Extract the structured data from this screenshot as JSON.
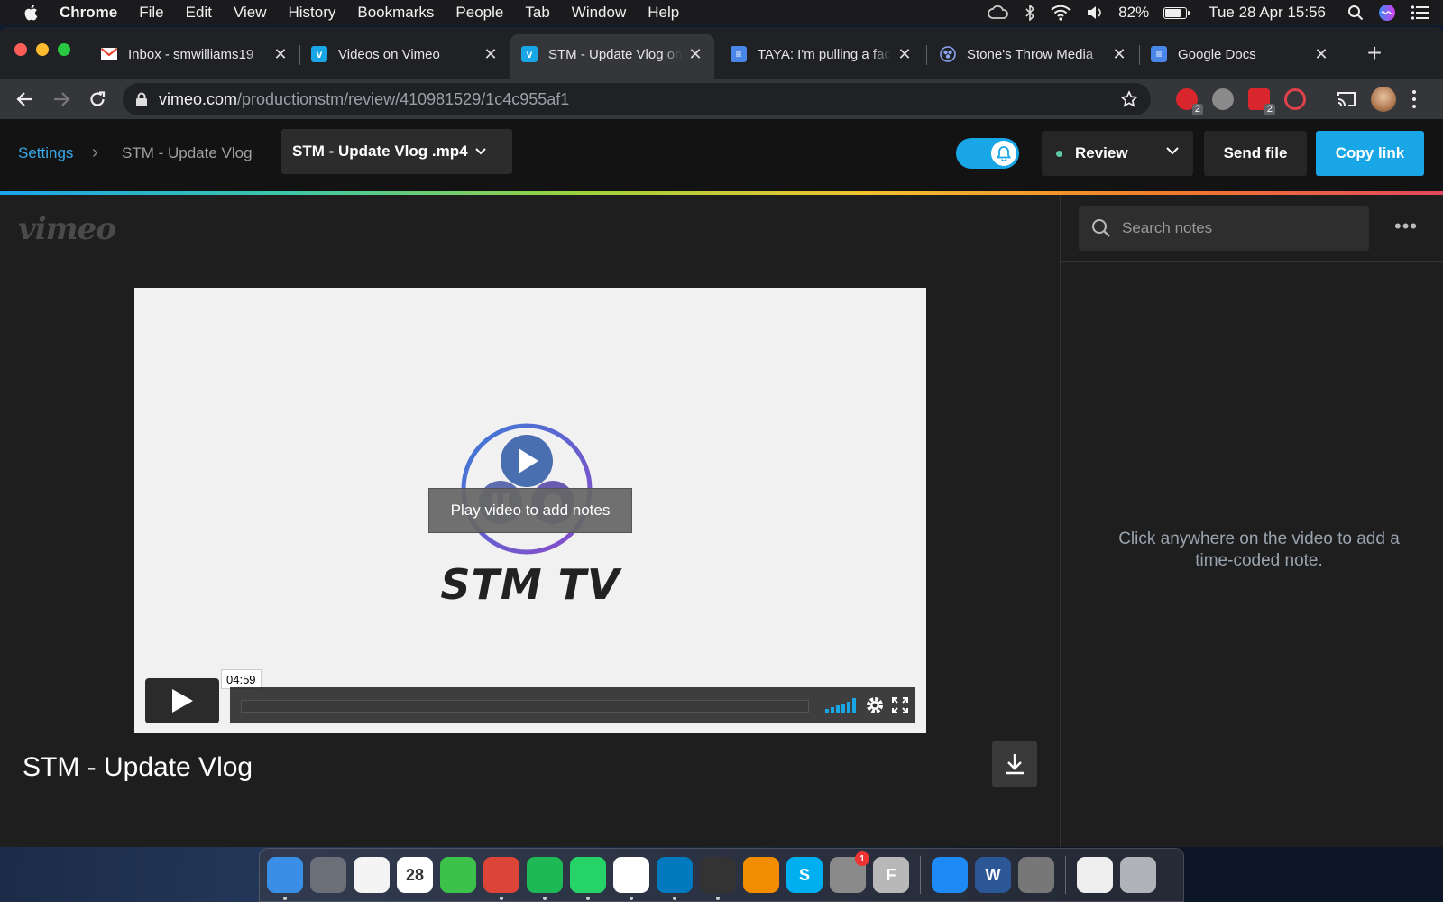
{
  "menubar": {
    "app": "Chrome",
    "menus": [
      "File",
      "Edit",
      "View",
      "History",
      "Bookmarks",
      "People",
      "Tab",
      "Window",
      "Help"
    ],
    "battery_pct": "82%",
    "battery_level": 0.82,
    "clock": "Tue 28 Apr  15:56"
  },
  "tabs": [
    {
      "title": "Inbox - smwilliams19",
      "icon": "gmail-icon",
      "color": "#ea4335"
    },
    {
      "title": "Videos on Vimeo",
      "icon": "vimeo-icon",
      "color": "#19a6e6"
    },
    {
      "title": "STM - Update Vlog on",
      "icon": "vimeo-icon",
      "color": "#19a6e6"
    },
    {
      "title": "TAYA: I'm pulling a fac",
      "icon": "docs-icon",
      "color": "#4a86e8"
    },
    {
      "title": "Stone's Throw Media",
      "icon": "stones-throw-icon",
      "color": "#6a8cd8"
    },
    {
      "title": "Google Docs",
      "icon": "docs-icon",
      "color": "#4a86e8"
    }
  ],
  "address": {
    "host": "vimeo.com",
    "path": "/productionstm/review/410981529/1c4c955af1"
  },
  "extensions": [
    {
      "name": "ext-red-badge",
      "badge": "2"
    },
    {
      "name": "ext-gray",
      "badge": ""
    },
    {
      "name": "ext-red-dots",
      "badge": "2"
    }
  ],
  "nav": {
    "settings": "Settings",
    "video_name": "STM - Update Vlog",
    "file_select": "STM - Update Vlog .mp4",
    "review": "Review",
    "send_file": "Send file",
    "copy_link": "Copy link"
  },
  "main": {
    "logo": "vimeo",
    "player_brand": "STM TV",
    "play_hint": "Play video to add notes",
    "timecode": "04:59",
    "title": "STM - Update Vlog"
  },
  "notes": {
    "search_placeholder": "Search notes",
    "more": "•••",
    "empty": "Click anywhere on the video to add a time-coded note."
  },
  "dock": [
    {
      "name": "finder-icon",
      "color": "#3a8ee6",
      "label": ""
    },
    {
      "name": "launchpad-icon",
      "color": "#6b6f78",
      "label": ""
    },
    {
      "name": "photos-icon",
      "color": "#f4f4f4",
      "label": ""
    },
    {
      "name": "calendar-icon",
      "color": "#ffffff",
      "label": "28"
    },
    {
      "name": "facetime-icon",
      "color": "#3cc24a",
      "label": ""
    },
    {
      "name": "chrome-icon",
      "color": "#db4437",
      "label": ""
    },
    {
      "name": "spotify-icon",
      "color": "#1db954",
      "label": ""
    },
    {
      "name": "whatsapp-icon",
      "color": "#25d366",
      "label": ""
    },
    {
      "name": "slack-icon",
      "color": "#ffffff",
      "label": ""
    },
    {
      "name": "trello-icon",
      "color": "#0079bf",
      "label": ""
    },
    {
      "name": "final-cut-icon",
      "color": "#333333",
      "label": ""
    },
    {
      "name": "vlc-icon",
      "color": "#f28c00",
      "label": ""
    },
    {
      "name": "skype-icon",
      "color": "#00aff0",
      "label": "S"
    },
    {
      "name": "system-prefs-icon",
      "color": "#8a8a8a",
      "label": "",
      "badge": "1"
    },
    {
      "name": "font-book-icon",
      "color": "#b8b8b8",
      "label": "F"
    },
    {
      "name": "safari-icon",
      "color": "#1e8af5",
      "label": ""
    },
    {
      "name": "word-icon",
      "color": "#2b5797",
      "label": "W"
    },
    {
      "name": "directory-utility-icon",
      "color": "#777777",
      "label": ""
    },
    {
      "name": "music-file-icon",
      "color": "#eeeeee",
      "label": ""
    },
    {
      "name": "trash-icon",
      "color": "#b0b4b8",
      "label": ""
    }
  ]
}
